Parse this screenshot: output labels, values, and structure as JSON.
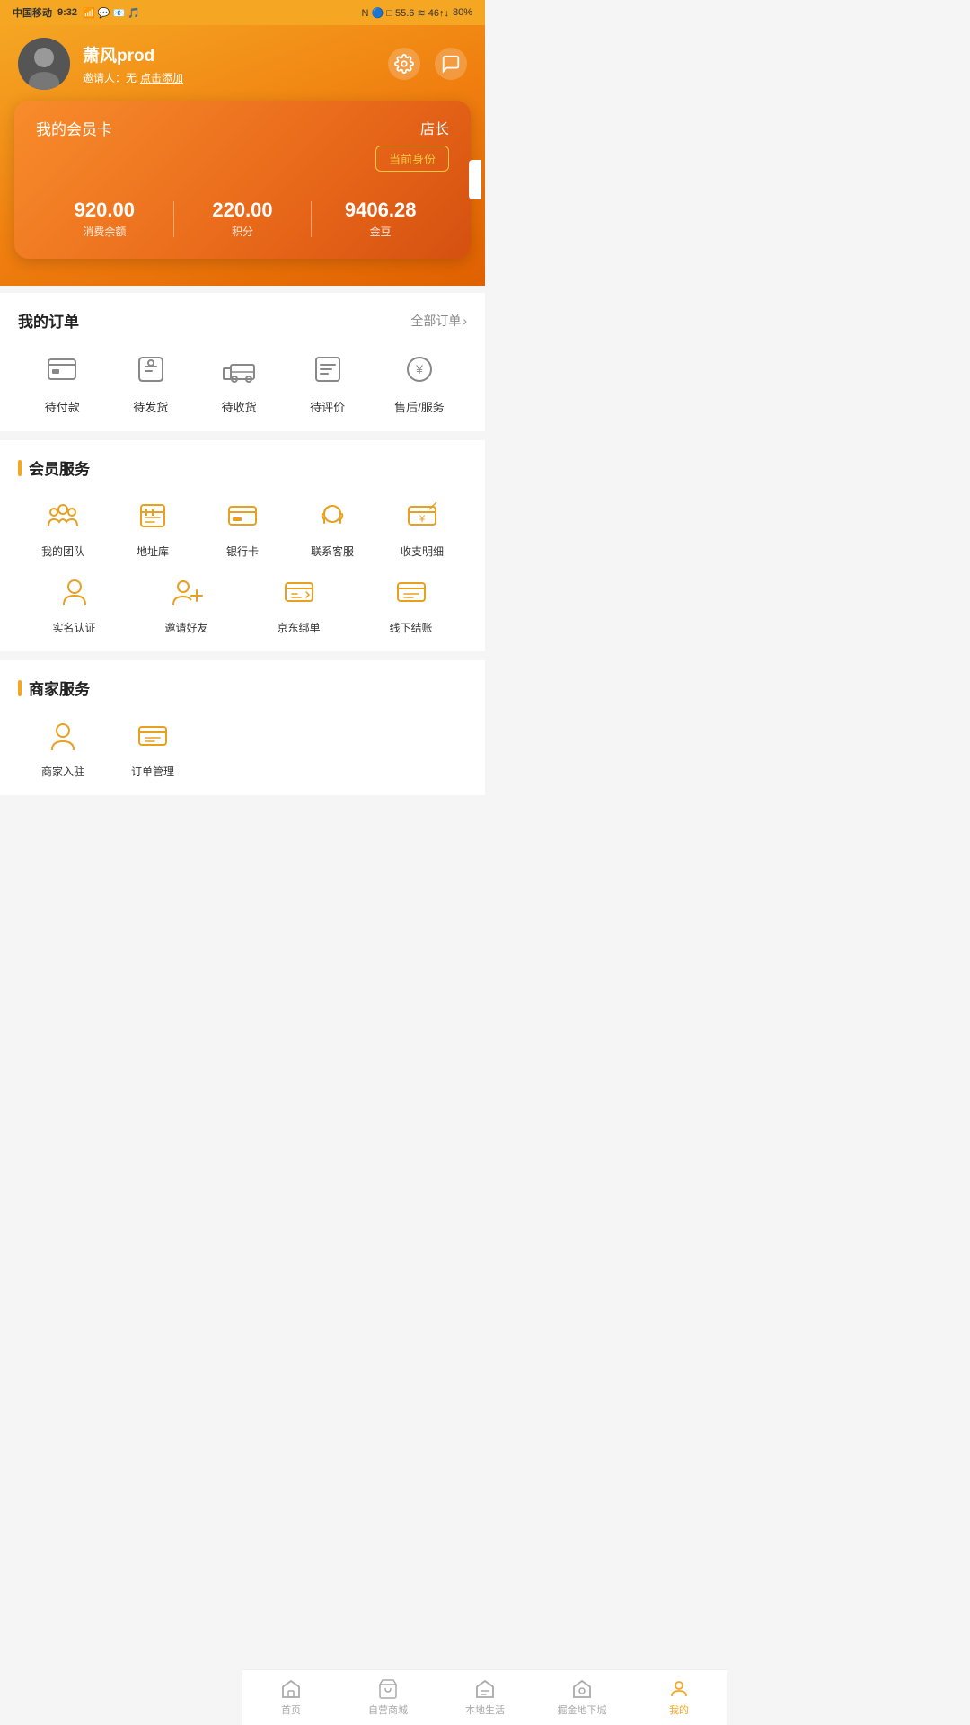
{
  "statusBar": {
    "carrier": "中国移动",
    "time": "9:32",
    "battery": "80%",
    "signal": "46"
  },
  "profile": {
    "username": "萧风prod",
    "inviteLabel": "邀请人：无",
    "inviteLink": "点击添加",
    "settingsIcon": "⚙",
    "messageIcon": "💬"
  },
  "memberCard": {
    "title": "我的会员卡",
    "role": "店长",
    "badgeLabel": "当前身份",
    "stats": [
      {
        "value": "920.00",
        "label": "消费余额"
      },
      {
        "value": "220.00",
        "label": "积分"
      },
      {
        "value": "9406.28",
        "label": "金豆"
      }
    ]
  },
  "orders": {
    "title": "我的订单",
    "allLabel": "全部订单",
    "items": [
      {
        "label": "待付款",
        "icon": "wallet"
      },
      {
        "label": "待发货",
        "icon": "bag"
      },
      {
        "label": "待收货",
        "icon": "truck"
      },
      {
        "label": "待评价",
        "icon": "clipboard"
      },
      {
        "label": "售后/服务",
        "icon": "yen"
      }
    ]
  },
  "memberServices": {
    "sectionTitle": "会员服务",
    "row1": [
      {
        "label": "我的团队",
        "icon": "team"
      },
      {
        "label": "地址库",
        "icon": "address"
      },
      {
        "label": "银行卡",
        "icon": "bank"
      },
      {
        "label": "联系客服",
        "icon": "headset"
      },
      {
        "label": "收支明细",
        "icon": "finance"
      }
    ],
    "row2": [
      {
        "label": "实名认证",
        "icon": "person"
      },
      {
        "label": "邀请好友",
        "icon": "addperson"
      },
      {
        "label": "京东绑单",
        "icon": "jd"
      },
      {
        "label": "线下结账",
        "icon": "offline"
      }
    ]
  },
  "merchantServices": {
    "sectionTitle": "商家服务",
    "items": [
      {
        "label": "商家入驻",
        "icon": "merchant"
      },
      {
        "label": "订单管理",
        "icon": "ordermgr"
      }
    ]
  },
  "bottomNav": {
    "items": [
      {
        "label": "首页",
        "icon": "home",
        "active": false
      },
      {
        "label": "自营商城",
        "icon": "shop",
        "active": false
      },
      {
        "label": "本地生活",
        "icon": "local",
        "active": false
      },
      {
        "label": "掘金地下城",
        "icon": "dungeon",
        "active": false
      },
      {
        "label": "我的",
        "icon": "person",
        "active": true
      }
    ]
  }
}
